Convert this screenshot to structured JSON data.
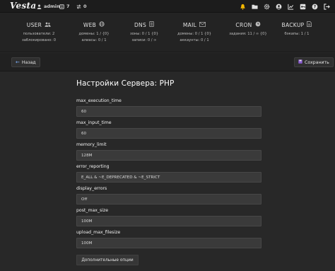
{
  "topbar": {
    "logo": "Vesta",
    "user": "admin",
    "count_a": "7",
    "count_b": "0"
  },
  "stats": [
    {
      "title": "USER",
      "lines": [
        "пользователи: 2",
        "заблокировано: 0"
      ]
    },
    {
      "title": "WEB",
      "lines": [
        "домены: 1 / {0}",
        "алиасы: 0 / 1"
      ]
    },
    {
      "title": "DNS",
      "lines": [
        "зоны: 0 / 1 {0}",
        "записи: 0 / ∞"
      ]
    },
    {
      "title": "MAIL",
      "lines": [
        "домены: 0 / 1 {0}",
        "аккаунты: 0 / 1"
      ]
    },
    {
      "title": "CRON",
      "lines": [
        "задания: 11 / ∞ {0}"
      ]
    },
    {
      "title": "BACKUP",
      "lines": [
        "бэкапы: 1 / 1"
      ]
    }
  ],
  "toolbar": {
    "back_label": "Назад",
    "save_label": "Сохранить"
  },
  "form": {
    "title": "Настройки Сервера: PHP",
    "fields": [
      {
        "label": "max_execution_time",
        "value": "60"
      },
      {
        "label": "max_input_time",
        "value": "60"
      },
      {
        "label": "memory_limit",
        "value": "128M"
      },
      {
        "label": "error_reporting",
        "value": "E_ALL & ~E_DEPRECATED & ~E_STRICT"
      },
      {
        "label": "display_errors",
        "value": "Off"
      },
      {
        "label": "post_max_size",
        "value": "100M"
      },
      {
        "label": "upload_max_filesize",
        "value": "100M"
      }
    ],
    "more_label": "Дополнительные опции"
  },
  "colors": {
    "background": "#282828",
    "topbar": "#1c1c1c",
    "bell_accent": "#f5b800",
    "save_icon": "#8a5cd0"
  },
  "icons": [
    "user-icon",
    "network-icon",
    "transfer-icon",
    "bell-icon",
    "folder-icon",
    "gear-icon",
    "account-icon",
    "chart-icon",
    "key-icon",
    "help-icon",
    "logout-icon"
  ]
}
